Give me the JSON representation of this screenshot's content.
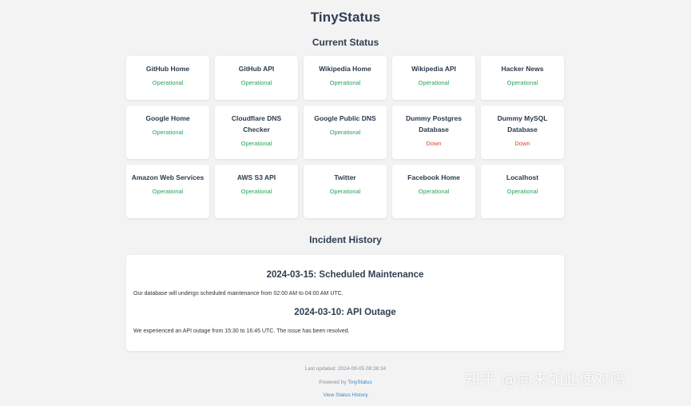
{
  "app": {
    "title": "TinyStatus"
  },
  "current_status": {
    "title": "Current Status",
    "services": [
      {
        "name": "GitHub Home",
        "status": "Operational",
        "state": "up"
      },
      {
        "name": "GitHub API",
        "status": "Operational",
        "state": "up"
      },
      {
        "name": "Wikipedia Home",
        "status": "Operational",
        "state": "up"
      },
      {
        "name": "Wikipedia API",
        "status": "Operational",
        "state": "up"
      },
      {
        "name": "Hacker News",
        "status": "Operational",
        "state": "up"
      },
      {
        "name": "Google Home",
        "status": "Operational",
        "state": "up"
      },
      {
        "name": "Cloudflare DNS Checker",
        "status": "Operational",
        "state": "up"
      },
      {
        "name": "Google Public DNS",
        "status": "Operational",
        "state": "up"
      },
      {
        "name": "Dummy Postgres Database",
        "status": "Down",
        "state": "down"
      },
      {
        "name": "Dummy MySQL Database",
        "status": "Down",
        "state": "down"
      },
      {
        "name": "Amazon Web Services",
        "status": "Operational",
        "state": "up"
      },
      {
        "name": "AWS S3 API",
        "status": "Operational",
        "state": "up"
      },
      {
        "name": "Twitter",
        "status": "Operational",
        "state": "up"
      },
      {
        "name": "Facebook Home",
        "status": "Operational",
        "state": "up"
      },
      {
        "name": "Localhost",
        "status": "Operational",
        "state": "up"
      }
    ]
  },
  "incident_history": {
    "title": "Incident History",
    "incidents": [
      {
        "heading": "2024-03-15: Scheduled Maintenance",
        "body": "Our database will undergo scheduled maintenance from 02:00 AM to 04:00 AM UTC."
      },
      {
        "heading": "2024-03-10: API Outage",
        "body": "We experienced an API outage from 15:30 to 16:45 UTC. The issue has been resolved."
      }
    ]
  },
  "footer": {
    "last_updated": "Last updated: 2024-09-05 08:38:34",
    "powered_prefix": "Powered by ",
    "powered_link": "TinyStatus",
    "history_link": "View Status History"
  },
  "watermark": "知乎 @向来如此便对吗",
  "colors": {
    "operational": "#25a55a",
    "down": "#d6492d",
    "link": "#3a86c8",
    "background": "#f3f3f4"
  }
}
